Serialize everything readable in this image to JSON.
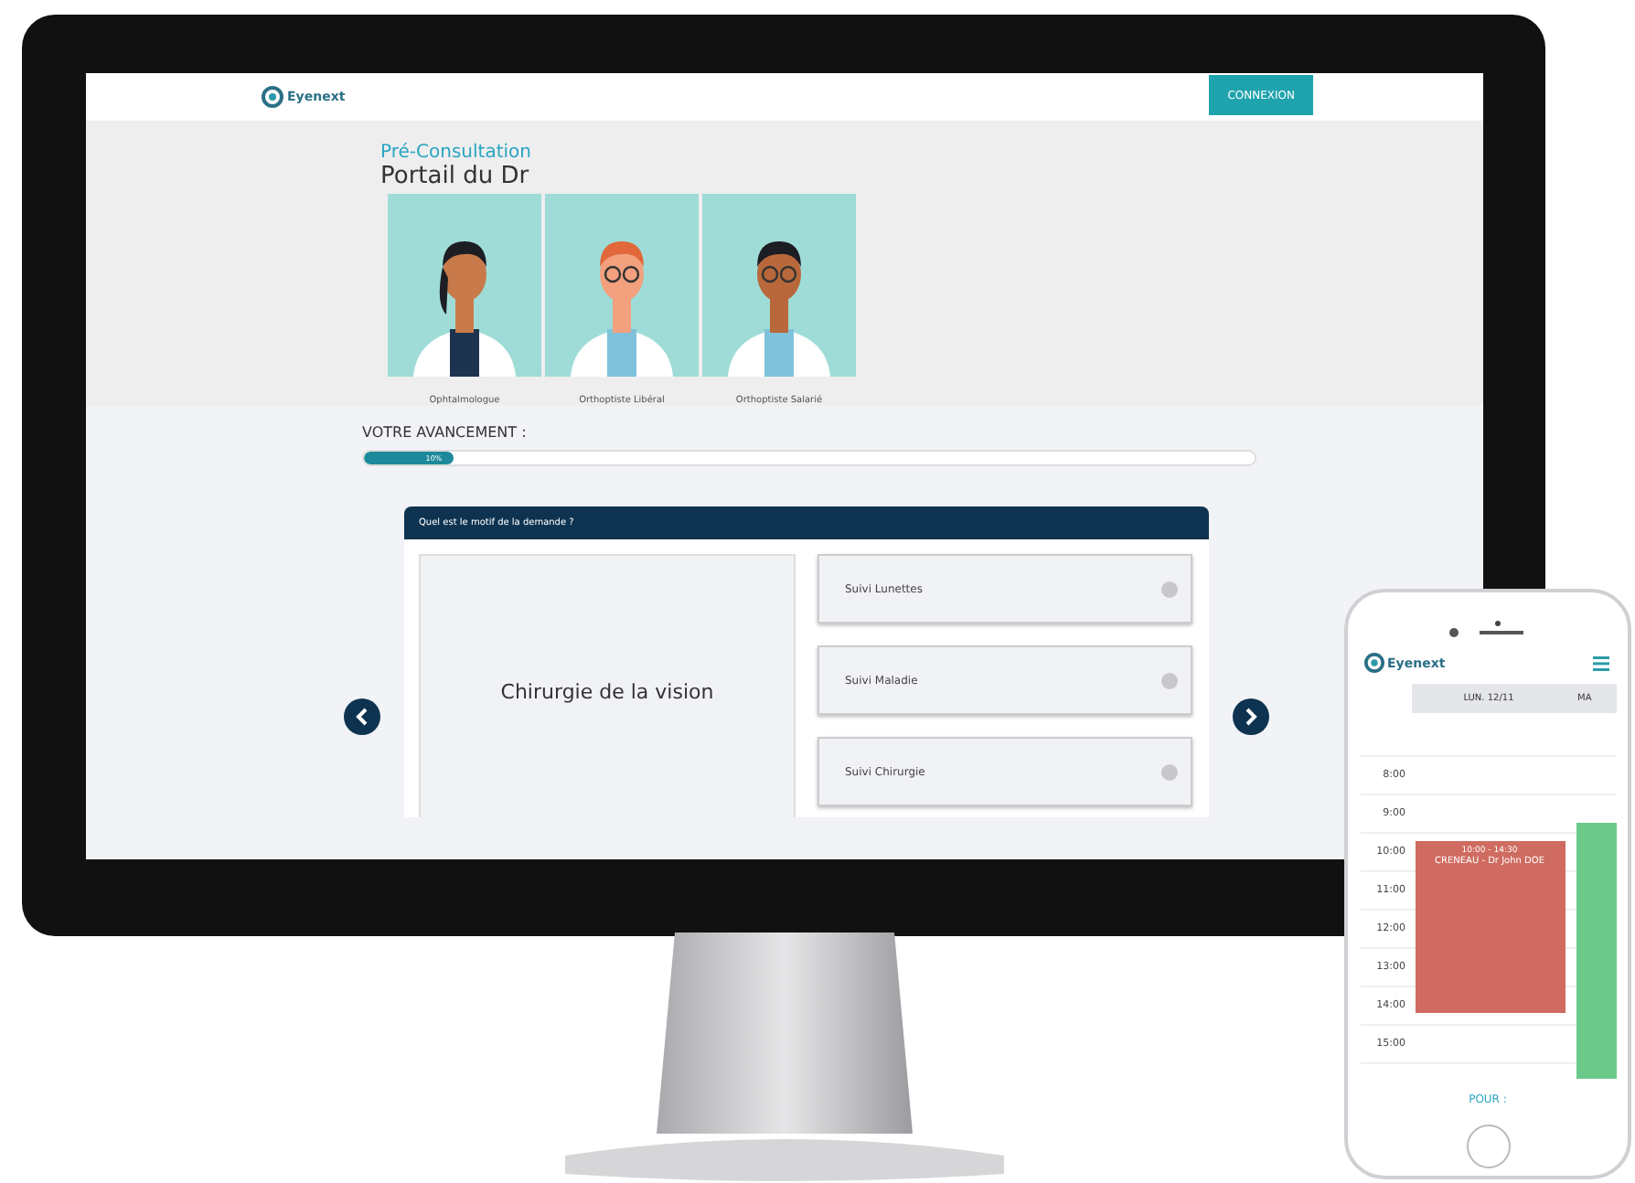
{
  "desktop": {
    "logo": "Eyenext",
    "login_button": "CONNEXION",
    "subtitle": "Pré-Consultation",
    "title": "Portail du Dr",
    "doctors": [
      {
        "label": "Ophtalmologue",
        "kind": "woman"
      },
      {
        "label": "Orthoptiste Libéral",
        "kind": "redhead"
      },
      {
        "label": "Orthoptiste Salarié",
        "kind": "man"
      }
    ],
    "progress": {
      "label": "VOTRE AVANCEMENT :",
      "level": 0.1,
      "reading": "10%"
    },
    "question": {
      "title": "Quel est le motif de la demande ?",
      "main_option": "Chirurgie de la vision",
      "options": [
        "Suivi Lunettes",
        "Suivi Maladie",
        "Suivi Chirurgie"
      ]
    }
  },
  "phone": {
    "logo": "Eyenext",
    "days": [
      "LUN. 12/11",
      "MA"
    ],
    "hours": [
      "8:00",
      "9:00",
      "10:00",
      "11:00",
      "12:00",
      "13:00",
      "14:00",
      "15:00"
    ],
    "events": [
      {
        "time": "10:00 - 14:30",
        "title": "CRENEAU - Dr John DOE",
        "color": "#cf6b60"
      }
    ],
    "footer": "POUR :"
  }
}
